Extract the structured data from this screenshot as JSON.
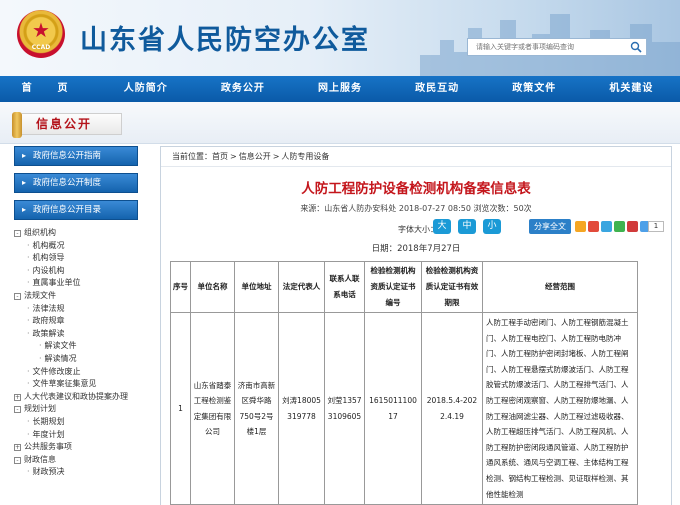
{
  "header": {
    "title": "山东省人民防空办公室",
    "logo_text": "CCAD",
    "search_placeholder": "请输入关键字或者事项编码查询"
  },
  "nav": [
    "首　页",
    "人防简介",
    "政务公开",
    "网上服务",
    "政民互动",
    "政策文件",
    "机关建设"
  ],
  "section_title": "信息公开",
  "sidebar": {
    "heads": [
      "政府信息公开指南",
      "政府信息公开制度",
      "政府信息公开目录"
    ],
    "tree": [
      {
        "label": "组织机构",
        "level": 0,
        "box": "-"
      },
      {
        "label": "机构概况",
        "level": 1
      },
      {
        "label": "机构领导",
        "level": 1
      },
      {
        "label": "内设机构",
        "level": 1
      },
      {
        "label": "直属事业单位",
        "level": 1
      },
      {
        "label": "法规文件",
        "level": 0,
        "box": "-"
      },
      {
        "label": "法律法规",
        "level": 1
      },
      {
        "label": "政府规章",
        "level": 1
      },
      {
        "label": "政策解读",
        "level": 1
      },
      {
        "label": "解读文件",
        "level": 2
      },
      {
        "label": "解读情况",
        "level": 2
      },
      {
        "label": "文件修改废止",
        "level": 1
      },
      {
        "label": "文件草案征集意见",
        "level": 1
      },
      {
        "label": "人大代表建议和政协提案办理",
        "level": 0,
        "box": "+"
      },
      {
        "label": "规划计划",
        "level": 0,
        "box": "-"
      },
      {
        "label": "长期规划",
        "level": 1
      },
      {
        "label": "年度计划",
        "level": 1
      },
      {
        "label": "公共服务事项",
        "level": 0,
        "box": "+"
      },
      {
        "label": "财政信息",
        "level": 0,
        "box": "-"
      },
      {
        "label": "财政预决",
        "level": 1
      }
    ]
  },
  "breadcrumb": {
    "prefix": "当前位置：",
    "items": [
      "首页",
      "信息公开",
      "人防专用设备"
    ],
    "sep": ">"
  },
  "article": {
    "title": "人防工程防护设备检测机构备案信息表",
    "meta": "来源：山东省人防办安科处  2018-07-27 08:50  浏览次数：50次",
    "font_size_label": "字体大小：",
    "font_sizes": [
      "大",
      "中",
      "小"
    ],
    "share_label": "分享全文",
    "share_count": "1",
    "date_line": "日期：2018年7月27日"
  },
  "table": {
    "headers": [
      "序号",
      "单位名称",
      "单位地址",
      "法定代表人",
      "联系人联系电话",
      "检验检测机构资质认定证书编号",
      "检验检测机构资质认定证书有效期限",
      "经营范围"
    ],
    "rows": [
      {
        "no": "1",
        "name": "山东省踏泰工程检测鉴定集团有限公司",
        "address": "济南市高新区舜华路750号2号楼1层",
        "legal_rep": "刘涛18005319778",
        "contact": "刘莹13573109605",
        "cert_no": "161501110017",
        "validity": "2018.5.4-2022.4.19",
        "scope": "人防工程手动密闭门、人防工程钢筋混凝土门、人防工程电控门、人防工程防电防冲门、人防工程防护密闭封堵板、人防工程闸门、人防工程悬摆式防爆波活门、人防工程胶管式防爆波活门、人防工程排气活门、人防工程密闭观察窗、人防工程防爆地漏、人防工程油网滤尘器、人防工程过滤吸收器、人防工程超压排气活门、人防工程风机、人防工程防护密闭段通风管道、人防工程防护通风系统、通风与空调工程、主体结构工程检测、钢结构工程检测、见证取样检测、其他性能检测"
      }
    ]
  },
  "colors": {
    "brand_blue": "#0f5a9c",
    "nav_blue": "#0a5aa8",
    "title_red": "#c4161c",
    "section_red": "#b4131b"
  },
  "icons": [
    "search-icon",
    "share-icons",
    "tree-toggle-icon"
  ]
}
